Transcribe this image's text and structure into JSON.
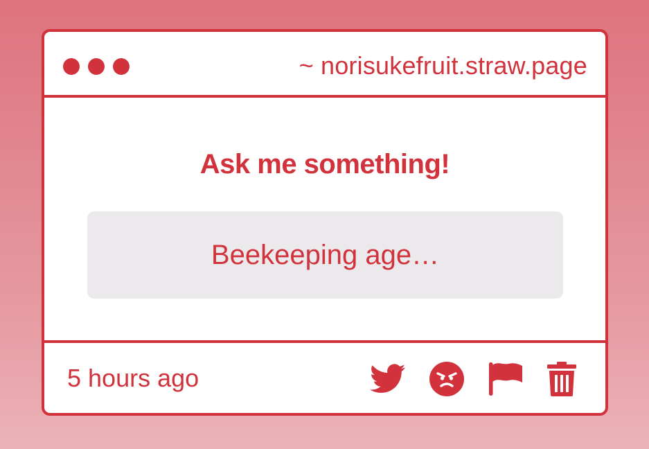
{
  "window": {
    "site_url": "~ norisukefruit.straw.page",
    "dots": [
      "dot",
      "dot",
      "dot"
    ]
  },
  "prompt": {
    "heading": "Ask me something!",
    "answer": "Beekeeping age…"
  },
  "footer": {
    "timestamp": "5 hours ago",
    "actions": [
      {
        "icon": "twitter-bird-icon"
      },
      {
        "icon": "angry-face-icon"
      },
      {
        "icon": "flag-icon"
      },
      {
        "icon": "trash-icon"
      }
    ]
  },
  "colors": {
    "accent": "#d1323b",
    "box_bg": "#ebe9eb",
    "card_bg": "#ffffff",
    "bg_top": "#dd737d",
    "bg_bottom": "#ebb3b8"
  }
}
